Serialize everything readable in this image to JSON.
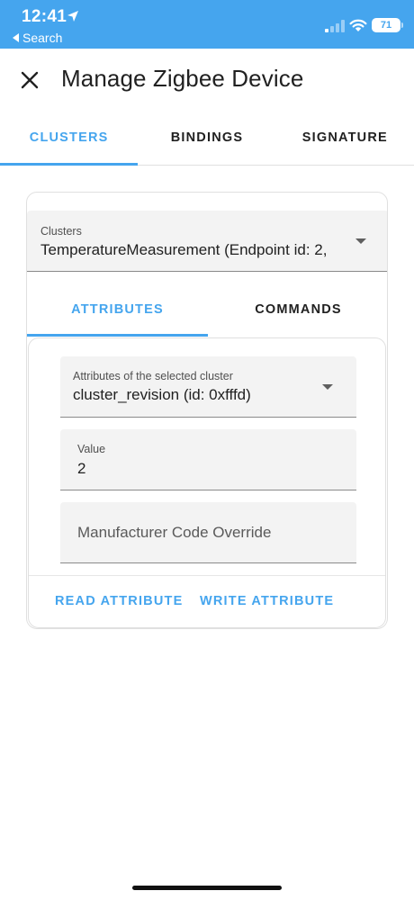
{
  "status_bar": {
    "time": "12:41",
    "back_label": "Search",
    "battery": "71",
    "location_icon": "location-arrow-icon",
    "signal_icon": "cellular-signal-icon",
    "wifi_icon": "wifi-icon"
  },
  "header": {
    "title": "Manage Zigbee Device",
    "close_icon": "close-icon"
  },
  "top_tabs": [
    {
      "label": "CLUSTERS",
      "active": true
    },
    {
      "label": "BINDINGS",
      "active": false
    },
    {
      "label": "SIGNATURE",
      "active": false
    }
  ],
  "clusters_select": {
    "label": "Clusters",
    "value": "TemperatureMeasurement (Endpoint id: 2,"
  },
  "inner_tabs": [
    {
      "label": "ATTRIBUTES",
      "active": true
    },
    {
      "label": "COMMANDS",
      "active": false
    }
  ],
  "attributes_select": {
    "label": "Attributes of the selected cluster",
    "value": "cluster_revision (id: 0xfffd)"
  },
  "value_field": {
    "label": "Value",
    "value": "2"
  },
  "manufacturer_field": {
    "placeholder": "Manufacturer Code Override"
  },
  "actions": {
    "read": "READ ATTRIBUTE",
    "write": "WRITE ATTRIBUTE"
  },
  "colors": {
    "accent": "#45a5ee",
    "status_bar": "#45a5ee",
    "field_bg": "#f3f3f3",
    "text": "#212121"
  }
}
